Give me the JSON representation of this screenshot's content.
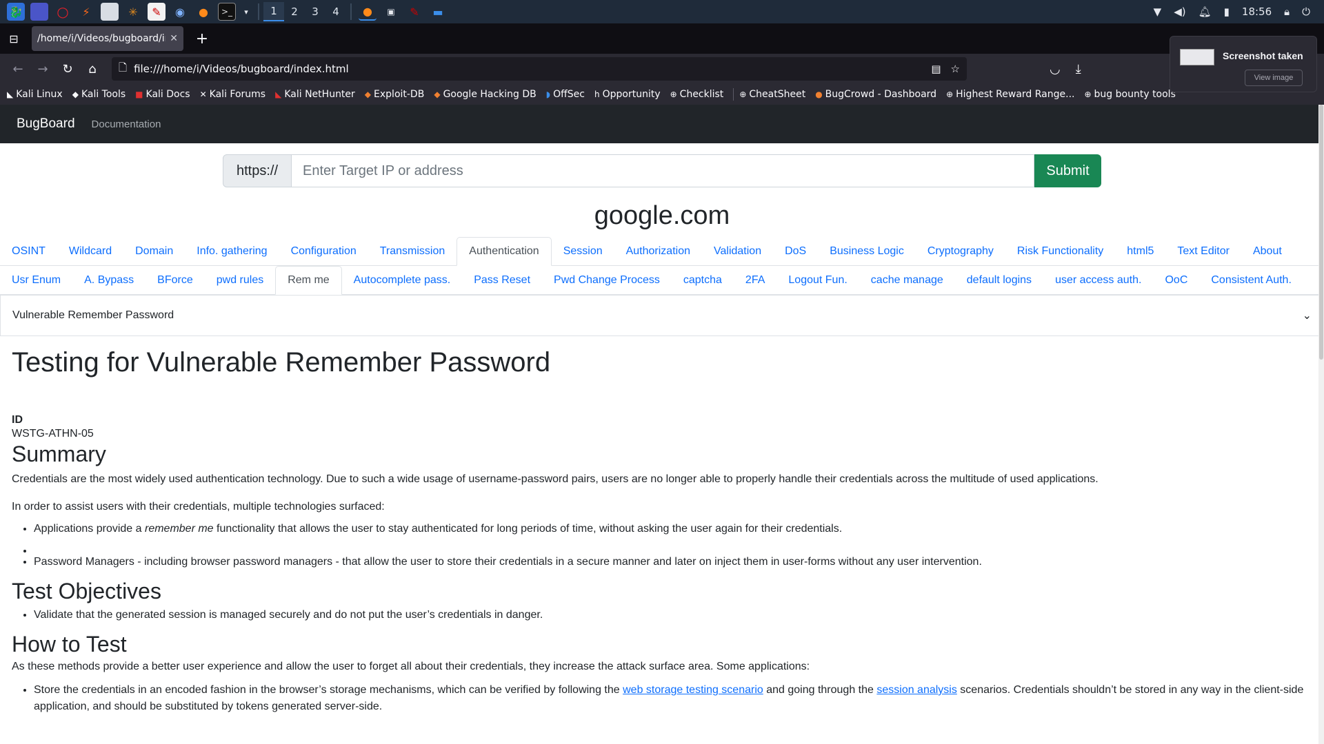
{
  "taskbar": {
    "workspaces": [
      "1",
      "2",
      "3",
      "4"
    ],
    "active_workspace": "1",
    "clock": "18:56",
    "icons": [
      "kali-menu-icon",
      "desktop-icon",
      "opera-icon",
      "burp-icon",
      "files-icon",
      "spider-icon",
      "editor-icon",
      "chrome-icon",
      "firefox-icon",
      "terminal-icon"
    ]
  },
  "browser": {
    "tab_title": "/home/i/Videos/bugboard/index.html",
    "url": "file:///home/i/Videos/bugboard/index.html",
    "bookmarks": [
      "Kali Linux",
      "Kali Tools",
      "Kali Docs",
      "Kali Forums",
      "Kali NetHunter",
      "Exploit-DB",
      "Google Hacking DB",
      "OffSec",
      "Opportunity",
      "Checklist",
      "CheatSheet",
      "BugCrowd - Dashboard",
      "Highest Reward Range...",
      "bug bounty tools"
    ]
  },
  "toast": {
    "title": "Screenshot taken",
    "button": "View image"
  },
  "app": {
    "brand": "BugBoard",
    "nav_link": "Documentation",
    "prefix": "https://",
    "placeholder": "Enter Target IP or address",
    "submit": "Submit",
    "domain": "google.com",
    "tabs_primary": [
      "OSINT",
      "Wildcard",
      "Domain",
      "Info. gathering",
      "Configuration",
      "Transmission",
      "Authentication",
      "Session",
      "Authorization",
      "Validation",
      "DoS",
      "Business Logic",
      "Cryptography",
      "Risk Functionality",
      "html5",
      "Text Editor",
      "About"
    ],
    "active_primary": "Authentication",
    "tabs_secondary": [
      "Usr Enum",
      "A. Bypass",
      "BForce",
      "pwd rules",
      "Rem me",
      "Autocomplete pass.",
      "Pass Reset",
      "Pwd Change Process",
      "captcha",
      "2FA",
      "Logout Fun.",
      "cache manage",
      "default logins",
      "user access auth.",
      "OoC",
      "Consistent Auth."
    ],
    "active_secondary": "Rem me",
    "accordion_title": "Vulnerable Remember Password"
  },
  "article": {
    "title": "Testing for Vulnerable Remember Password",
    "id_label": "ID",
    "id_value": "WSTG-ATHN-05",
    "summary_heading": "Summary",
    "summary_p1": "Credentials are the most widely used authentication technology. Due to such a wide usage of username-password pairs, users are no longer able to properly handle their credentials across the multitude of used applications.",
    "summary_p2": "In order to assist users with their credentials, multiple technologies surfaced:",
    "bullet1_pre": "Applications provide a ",
    "bullet1_em": "remember me",
    "bullet1_post": " functionality that allows the user to stay authenticated for long periods of time, without asking the user again for their credentials.",
    "bullet3": "Password Managers - including browser password managers - that allow the user to store their credentials in a secure manner and later on inject them in user-forms without any user intervention.",
    "objectives_heading": "Test Objectives",
    "objective1": "Validate that the generated session is managed securely and do not put the user’s credentials in danger.",
    "howto_heading": "How to Test",
    "howto_p": "As these methods provide a better user experience and allow the user to forget all about their credentials, they increase the attack surface area. Some applications:",
    "howto_b1_pre": "Store the credentials in an encoded fashion in the browser’s storage mechanisms, which can be verified by following the ",
    "howto_b1_link1": "web storage testing scenario",
    "howto_b1_mid": " and going through the ",
    "howto_b1_link2": "session analysis",
    "howto_b1_post": " scenarios. Credentials shouldn’t be stored in any way in the client-side application, and should be substituted by tokens generated server-side."
  }
}
